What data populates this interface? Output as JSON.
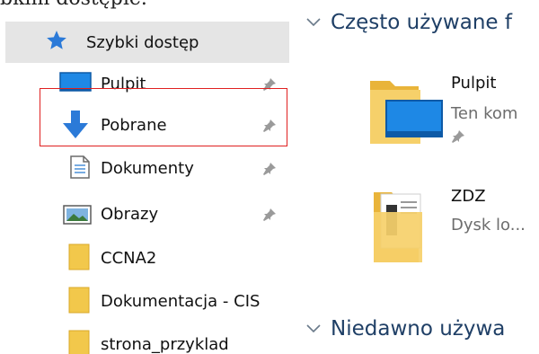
{
  "caption": "bkim dostępie.",
  "sidebar": {
    "items": [
      {
        "label": "Szybki dostęp",
        "icon": "star-icon",
        "pinned": false
      },
      {
        "label": "Pulpit",
        "icon": "desktop-icon",
        "pinned": true
      },
      {
        "label": "Pobrane",
        "icon": "download-arrow-icon",
        "pinned": true
      },
      {
        "label": "Dokumenty",
        "icon": "document-icon",
        "pinned": true
      },
      {
        "label": "Obrazy",
        "icon": "pictures-icon",
        "pinned": true
      },
      {
        "label": "CCNA2",
        "icon": "folder-icon",
        "pinned": false
      },
      {
        "label": "Dokumentacja - CIS",
        "icon": "folder-icon",
        "pinned": false
      },
      {
        "label": "strona_przyklad",
        "icon": "folder-icon",
        "pinned": false
      }
    ]
  },
  "main": {
    "frequent_heading": "Często używane f",
    "recent_heading": "Niedawno używa",
    "tiles": [
      {
        "title": "Pulpit",
        "subtitle": "Ten kom",
        "icon": "desktop-folder-icon",
        "pinned": true
      },
      {
        "title": "ZDZ",
        "subtitle": "Dysk lo...",
        "icon": "folder-icon",
        "pinned": false
      }
    ]
  },
  "colors": {
    "selected_bg": "#e5e5e5",
    "highlight_border": "#e02020",
    "heading": "#1f3f66",
    "folder": "#f2c84b",
    "accent_blue": "#2b7ad8"
  }
}
